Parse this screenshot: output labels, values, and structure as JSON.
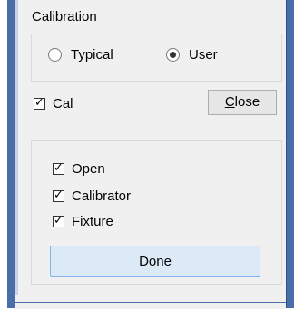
{
  "calibration_group": {
    "title": "Calibration",
    "options": [
      {
        "label": "Typical",
        "selected": false
      },
      {
        "label": "User",
        "selected": true
      }
    ]
  },
  "cal": {
    "label": "Cal",
    "checked": true
  },
  "close_button": {
    "label_underlined": "C",
    "label_rest": "lose"
  },
  "lower_group": {
    "items": [
      {
        "label": "Open",
        "checked": true
      },
      {
        "label": "Calibrator",
        "checked": true
      },
      {
        "label": "Fixture",
        "checked": true
      }
    ],
    "done_label": "Done"
  },
  "icons": {
    "check": "check-icon",
    "radio_dot": "radio-dot-icon"
  }
}
